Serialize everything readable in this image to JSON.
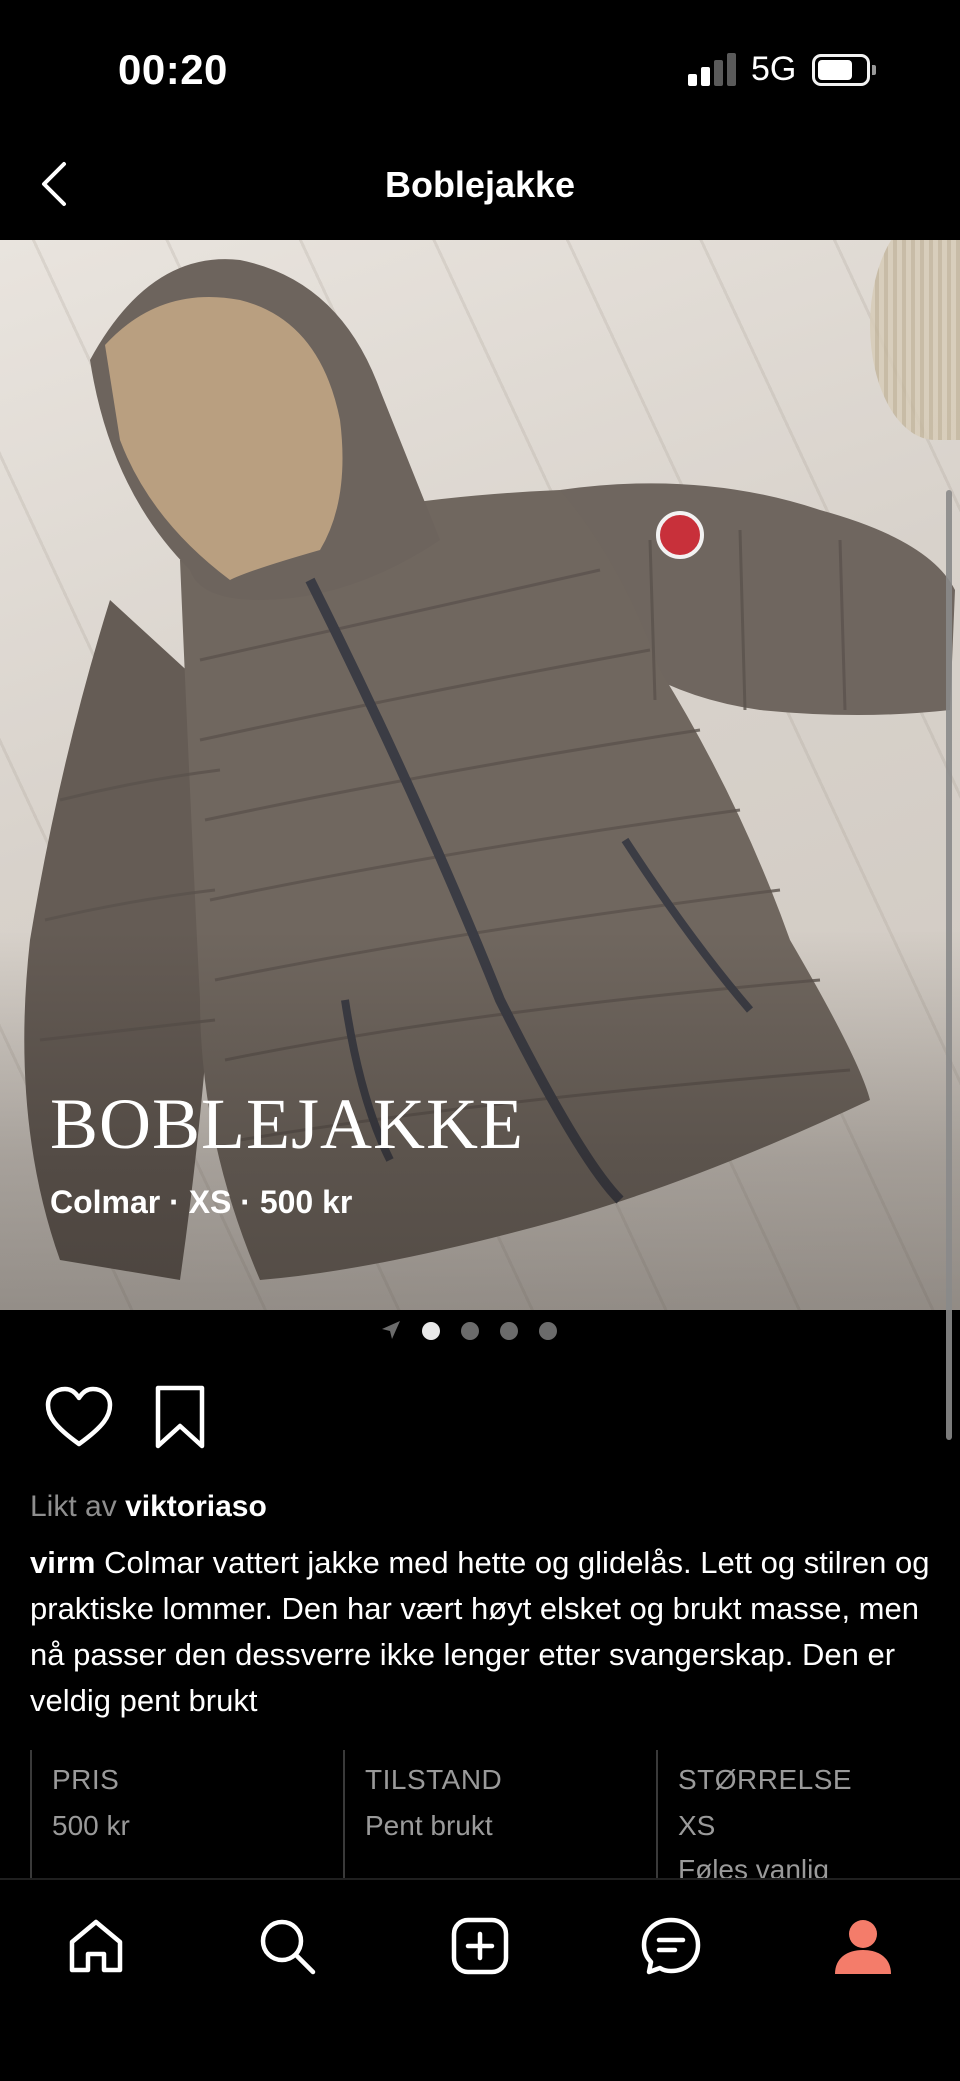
{
  "status_bar": {
    "time": "00:20",
    "network": "5G"
  },
  "nav": {
    "title": "Boblejakke"
  },
  "hero": {
    "title": "BOBLEJAKKE",
    "subtitle": "Colmar · XS · 500 kr",
    "page_count": 4,
    "active_page": 1
  },
  "likes": {
    "prefix": "Likt av",
    "user": "viktoriaso"
  },
  "description": {
    "author": "virm",
    "text": "Colmar vattert jakke med hette og glidelås. Lett og stilren og praktiske lommer. Den har vært høyt elsket og brukt masse, men nå passer den dessverre ikke lenger etter svangerskap. Den er veldig pent brukt"
  },
  "info": {
    "price": {
      "label": "PRIS",
      "value": "500 kr"
    },
    "condition": {
      "label": "TILSTAND",
      "value": "Pent brukt"
    },
    "size": {
      "label": "STØRRELSE",
      "value": "XS",
      "note": "Føles vanlig"
    }
  },
  "tabs": [
    {
      "icon": "home-icon"
    },
    {
      "icon": "search-icon"
    },
    {
      "icon": "add-icon"
    },
    {
      "icon": "messages-icon"
    },
    {
      "icon": "profile-icon",
      "active_color": "#f47c6a"
    }
  ]
}
